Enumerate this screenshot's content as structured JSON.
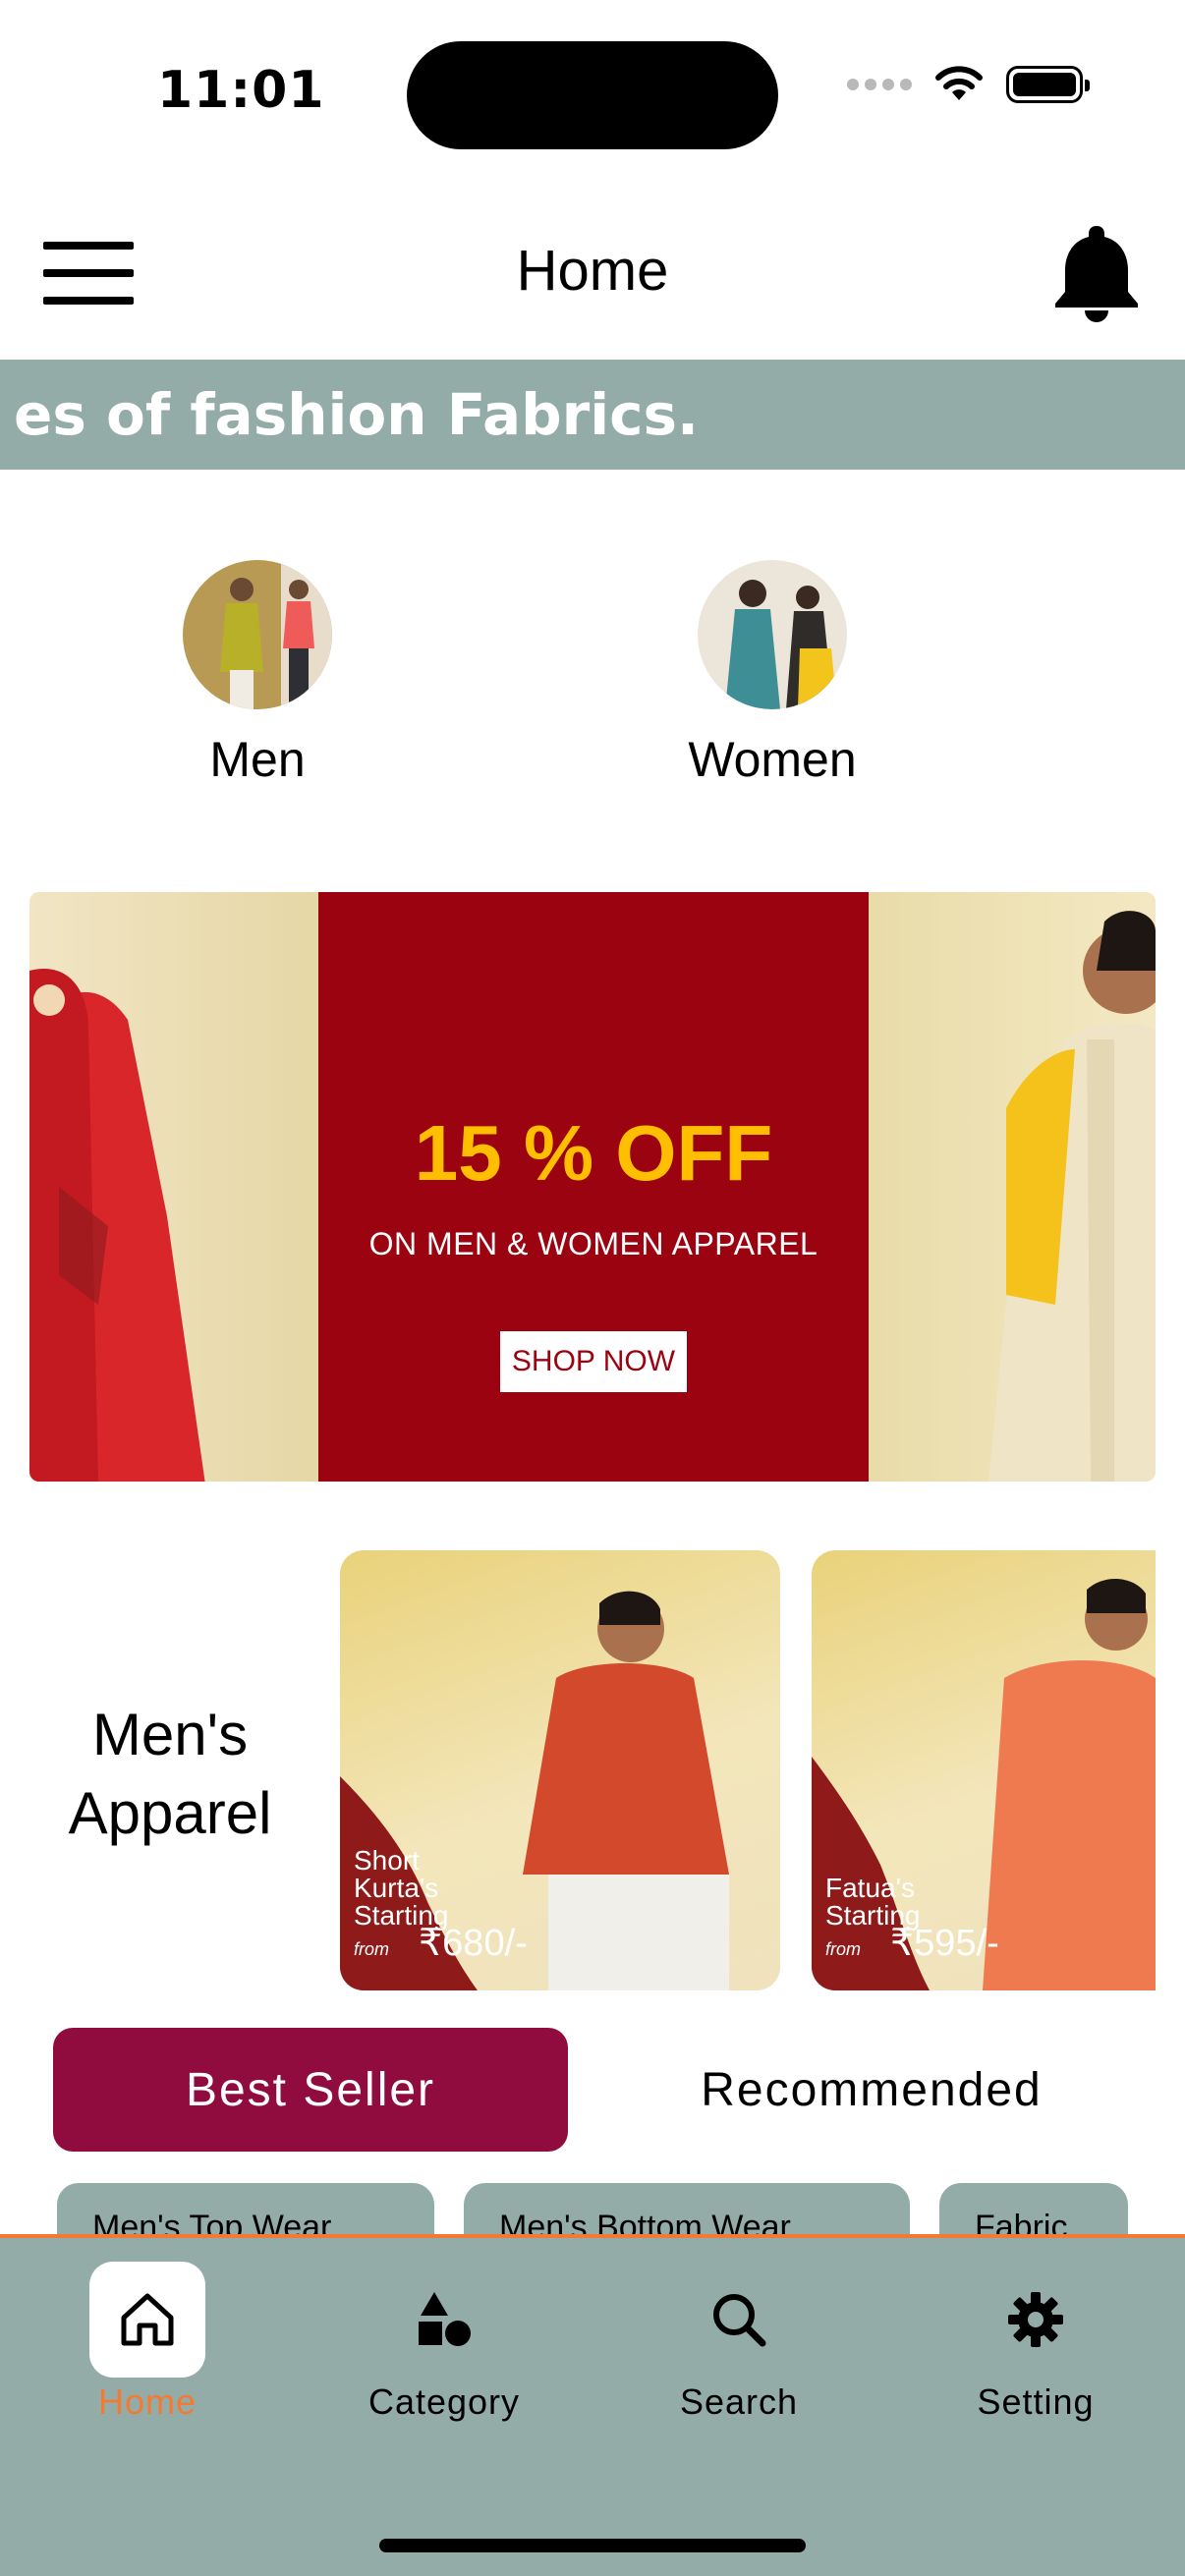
{
  "status_bar": {
    "time": "11:01"
  },
  "header": {
    "title": "Home"
  },
  "marquee": {
    "text": "es of fashion Fabrics."
  },
  "categories": [
    {
      "label": "Men"
    },
    {
      "label": "Women"
    }
  ],
  "banner": {
    "headline": "15 % OFF",
    "subline": "ON MEN & WOMEN APPAREL",
    "cta": "SHOP NOW"
  },
  "mens_apparel": {
    "title_line1": "Men's",
    "title_line2": "Apparel",
    "promos": [
      {
        "line1": "Short",
        "line2": "Kurta's",
        "line3": "Starting",
        "from": "from",
        "price": "₹680/-"
      },
      {
        "line1": "Fatua's",
        "line2": "Starting",
        "from": "from",
        "price": "₹595/-"
      }
    ]
  },
  "tabs": {
    "best_seller": "Best Seller",
    "recommended": "Recommended"
  },
  "chips": [
    {
      "label": "Men's Top Wear"
    },
    {
      "label": "Men's Bottom Wear"
    },
    {
      "label": "Fabric"
    }
  ],
  "bottom_nav": [
    {
      "label": "Home",
      "icon": "home-icon"
    },
    {
      "label": "Category",
      "icon": "category-icon"
    },
    {
      "label": "Search",
      "icon": "search-icon"
    },
    {
      "label": "Setting",
      "icon": "gear-icon"
    }
  ],
  "colors": {
    "accent": "#f47a33",
    "tab_active": "#900c3f",
    "nav_bg": "#93aca8",
    "banner_red": "#9b0310",
    "banner_gold": "#ffbf00"
  }
}
